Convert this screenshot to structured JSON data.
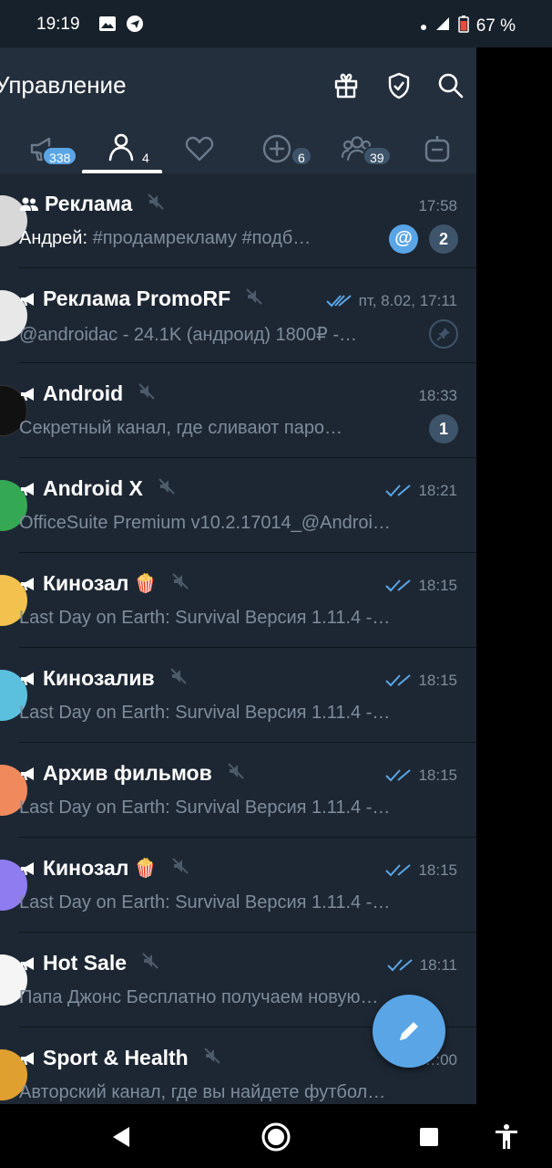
{
  "status_bar": {
    "time": "19:19",
    "battery": "67 %",
    "icons": [
      "image-icon",
      "telegram-icon",
      "dot-icon",
      "signal-icon",
      "battery-icon"
    ]
  },
  "header": {
    "title": "Управление",
    "actions": [
      "gift-icon",
      "shield-icon",
      "search-icon"
    ]
  },
  "tabs": [
    {
      "icon": "megaphone-icon",
      "badge": "338",
      "active": false
    },
    {
      "icon": "person-icon",
      "badge": "4",
      "active": true
    },
    {
      "icon": "heart-icon",
      "badge": "",
      "active": false
    },
    {
      "icon": "add-circle-icon",
      "badge": "6",
      "active": false
    },
    {
      "icon": "group-icon",
      "badge": "39",
      "active": false
    },
    {
      "icon": "bot-icon",
      "badge": "",
      "active": false
    }
  ],
  "chats": [
    {
      "type": "group",
      "name": "Реклама",
      "time": "17:58",
      "sender": "Андрей:",
      "preview": "#продамрекламу #подб…",
      "mention": "@",
      "unread": "2",
      "avatar_color": "#d8d8d8"
    },
    {
      "type": "channel",
      "name": "Реклама PromoRF",
      "time": "пт, 8.02, 17:11",
      "read": true,
      "preview": "@androidac - 24.1K (андроид) 1800₽ -…",
      "pinned": true,
      "avatar_color": "#e8e8e8"
    },
    {
      "type": "channel",
      "name": "Android",
      "time": "18:33",
      "preview": "Секретный канал, где сливают паро…",
      "unread": "1",
      "avatar_color": "#111111"
    },
    {
      "type": "channel",
      "name": "Android X",
      "time": "18:21",
      "read": true,
      "preview": "OfficeSuite Premium v10.2.17014_@Androi…",
      "avatar_color": "#34a853"
    },
    {
      "type": "channel",
      "name": "Кинозал",
      "emoji": "🍿",
      "time": "18:15",
      "read": true,
      "preview": "Last Day on Earth: Survival Версия 1.11.4  -…",
      "avatar_color": "#f2c14e"
    },
    {
      "type": "channel",
      "name": "Кинозалив",
      "time": "18:15",
      "read": true,
      "preview": "Last Day on Earth: Survival Версия 1.11.4  -…",
      "avatar_color": "#5bc0de"
    },
    {
      "type": "channel",
      "name": "Архив фильмов",
      "time": "18:15",
      "read": true,
      "preview": "Last Day on Earth: Survival Версия 1.11.4  -…",
      "avatar_color": "#f08a5d"
    },
    {
      "type": "channel",
      "name": "Кинозал",
      "emoji": "🍿",
      "time": "18:15",
      "read": true,
      "preview": "Last Day on Earth: Survival Версия 1.11.4  -…",
      "avatar_color": "#8e7cf0"
    },
    {
      "type": "channel",
      "name": "Hot Sale",
      "time": "18:11",
      "read": true,
      "preview": "Папа Джонс Бесплатно получаем новую…",
      "avatar_color": "#f5f5f5"
    },
    {
      "type": "channel",
      "name": "Sport & Health",
      "time": "…:00",
      "preview": "Авторский канал, где вы найдете футбол…",
      "avatar_color": "#e0a030"
    }
  ],
  "fab": {
    "icon": "pencil-icon"
  },
  "navbar": [
    "back-icon",
    "home-icon",
    "recents-icon",
    "accessibility-icon"
  ],
  "colors": {
    "accent": "#5aa5e6",
    "header_bg": "#242f3d",
    "list_bg": "#1d2733",
    "muted_text": "#7e8c9b"
  }
}
